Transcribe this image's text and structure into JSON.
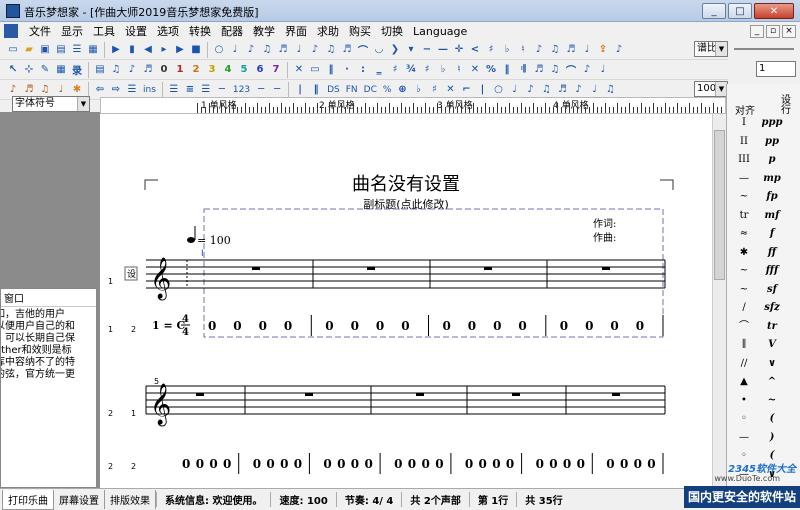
{
  "window": {
    "title": "音乐梦想家 - [作曲大师2019音乐梦想家免费版]",
    "buttons": {
      "minimize": "_",
      "maximize": "□",
      "close": "✕"
    }
  },
  "menu": [
    "文件",
    "显示",
    "工具",
    "设置",
    "选项",
    "转换",
    "配器",
    "教学",
    "界面",
    "求助",
    "购买",
    "切换",
    "Language"
  ],
  "toolbar": {
    "row1_right_combo": "谱比",
    "row2_right_value": "1",
    "row3_labels": [
      "ins",
      "123",
      "DS",
      "FN",
      "DC",
      "%"
    ],
    "zoom": "100%",
    "side_labels": [
      "直出",
      "对齐",
      "设行"
    ]
  },
  "font_combo": {
    "value": "字体符号"
  },
  "ruler": {
    "measures": [
      "单风格",
      "单风格",
      "单风格",
      "单风格"
    ]
  },
  "score": {
    "title": "曲名没有设置",
    "subtitle": "副标题(点此修改)",
    "lyricist_label": "作词:",
    "composer_label": "作曲:",
    "tempo": "= 100",
    "key": "1 = C",
    "time_top": "4",
    "time_bottom": "4",
    "staff_mark": "设",
    "measure_number": "5",
    "row_labels": [
      {
        "a": "1",
        "b": "1"
      },
      {
        "a": "1",
        "b": "2"
      },
      {
        "a": "2",
        "b": "1"
      },
      {
        "a": "2",
        "b": "2"
      }
    ],
    "jianpu_row1": [
      [
        "0",
        "0",
        "0",
        "0"
      ],
      [
        "0",
        "0",
        "0",
        "0"
      ],
      [
        "0",
        "0",
        "0",
        "0"
      ],
      [
        "0",
        "0",
        "0",
        "0"
      ]
    ],
    "jianpu_row2": [
      [
        "0",
        "0",
        "0",
        "0"
      ],
      [
        "0",
        "0",
        "0",
        "0"
      ],
      [
        "0",
        "0",
        "0",
        "0"
      ],
      [
        "0",
        "0",
        "0",
        "0"
      ],
      [
        "0",
        "0",
        "0",
        "0"
      ],
      [
        "0",
        "0",
        "0",
        "0"
      ],
      [
        "0",
        "0",
        "0",
        "0"
      ]
    ]
  },
  "left_panel": {
    "header": "窗口",
    "text": "如，吉他的用户\n以便用户自己的和\n，可以长期自己保\nother和效则是标\n库中容纳不了的特\n的弦，官方统一更"
  },
  "palette": {
    "col1": [
      "I",
      "II",
      "III",
      "—",
      "~",
      "tr",
      "≈",
      "✱",
      "~",
      "~",
      "/",
      "⌒",
      "∥",
      "∕∕",
      "▲",
      "•",
      "◦",
      "—",
      "◦",
      "—",
      "◦"
    ],
    "col2": [
      "ppp",
      "pp",
      "p",
      "mp",
      "fp",
      "mf",
      "f",
      "ff",
      "fff",
      "sf",
      "sfz",
      "tr",
      "V",
      "∨",
      "^",
      "~",
      "(",
      ")",
      "(",
      "∨",
      "✓"
    ]
  },
  "status": {
    "tabs": [
      "打印乐曲",
      "屏幕设置",
      "排版效果"
    ],
    "system_info": "系统信息: 欢迎使用。",
    "speed": "速度: 100",
    "meter": "节奏: 4/ 4",
    "parts": "共 2个声部",
    "line": "第 1行",
    "rows": "共 35行"
  },
  "watermark": {
    "brand": "2345软件大全",
    "url": "www.DuoTe.com",
    "slogan": "国内更安全的软件站"
  }
}
